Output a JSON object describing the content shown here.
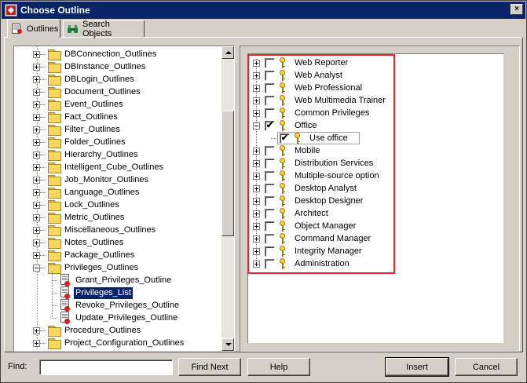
{
  "window": {
    "title": "Choose Outline",
    "close_label": "×"
  },
  "tabs": [
    {
      "label": "Outlines",
      "icon": "outline-doc-icon",
      "active": true
    },
    {
      "label": "Search Objects",
      "icon": "binoculars-icon",
      "active": false
    }
  ],
  "left_tree": {
    "items": [
      {
        "label": "DBConnection_Outlines",
        "type": "folder",
        "expanded": false
      },
      {
        "label": "DBInstance_Outlines",
        "type": "folder",
        "expanded": false
      },
      {
        "label": "DBLogin_Outlines",
        "type": "folder",
        "expanded": false
      },
      {
        "label": "Document_Outlines",
        "type": "folder",
        "expanded": false
      },
      {
        "label": "Event_Outlines",
        "type": "folder",
        "expanded": false
      },
      {
        "label": "Fact_Outlines",
        "type": "folder",
        "expanded": false
      },
      {
        "label": "Filter_Outlines",
        "type": "folder",
        "expanded": false
      },
      {
        "label": "Folder_Outlines",
        "type": "folder",
        "expanded": false
      },
      {
        "label": "Hierarchy_Outlines",
        "type": "folder",
        "expanded": false
      },
      {
        "label": "Intelligent_Cube_Outlines",
        "type": "folder",
        "expanded": false
      },
      {
        "label": "Job_Monitor_Outlines",
        "type": "folder",
        "expanded": false
      },
      {
        "label": "Language_Outlines",
        "type": "folder",
        "expanded": false
      },
      {
        "label": "Lock_Outlines",
        "type": "folder",
        "expanded": false
      },
      {
        "label": "Metric_Outlines",
        "type": "folder",
        "expanded": false
      },
      {
        "label": "Miscellaneous_Outlines",
        "type": "folder",
        "expanded": false
      },
      {
        "label": "Notes_Outlines",
        "type": "folder",
        "expanded": false
      },
      {
        "label": "Package_Outlines",
        "type": "folder",
        "expanded": false
      },
      {
        "label": "Privileges_Outlines",
        "type": "folder",
        "expanded": true
      },
      {
        "label": "Grant_Privileges_Outline",
        "type": "doc",
        "selected": false
      },
      {
        "label": "Privileges_List",
        "type": "doc",
        "selected": true
      },
      {
        "label": "Revoke_Privileges_Outline",
        "type": "doc",
        "selected": false
      },
      {
        "label": "Update_Privileges_Outline",
        "type": "doc",
        "selected": false
      },
      {
        "label": "Procedure_Outlines",
        "type": "folder",
        "expanded": false
      },
      {
        "label": "Project_Configuration_Outlines",
        "type": "folder",
        "expanded": false
      }
    ]
  },
  "right_tree": {
    "items": [
      {
        "label": "Web Reporter",
        "checked": false,
        "expanded": false
      },
      {
        "label": "Web Analyst",
        "checked": false,
        "expanded": false
      },
      {
        "label": "Web Professional",
        "checked": false,
        "expanded": false
      },
      {
        "label": "Web Multimedia Trainer",
        "checked": false,
        "expanded": false
      },
      {
        "label": "Common Privileges",
        "checked": false,
        "expanded": false
      },
      {
        "label": "Office",
        "checked": true,
        "expanded": true
      },
      {
        "label": "Use office",
        "checked": true,
        "child": true
      },
      {
        "label": "Mobile",
        "checked": false,
        "expanded": false
      },
      {
        "label": "Distribution Services",
        "checked": false,
        "expanded": false
      },
      {
        "label": "Multiple-source option",
        "checked": false,
        "expanded": false
      },
      {
        "label": "Desktop Analyst",
        "checked": false,
        "expanded": false
      },
      {
        "label": "Desktop Designer",
        "checked": false,
        "expanded": false
      },
      {
        "label": "Architect",
        "checked": false,
        "expanded": false
      },
      {
        "label": "Object Manager",
        "checked": false,
        "expanded": false
      },
      {
        "label": "Command Manager",
        "checked": false,
        "expanded": false
      },
      {
        "label": "Integrity Manager",
        "checked": false,
        "expanded": false
      },
      {
        "label": "Administration",
        "checked": false,
        "expanded": false
      }
    ],
    "check_mark": "✔"
  },
  "footer": {
    "find_label": "Find:",
    "find_value": "",
    "find_next_label": "Find Next",
    "help_label": "Help",
    "insert_label": "Insert",
    "cancel_label": "Cancel"
  },
  "colors": {
    "titlebar": "#0a246a",
    "highlight_border": "#e8242c",
    "selection": "#0a246a"
  }
}
